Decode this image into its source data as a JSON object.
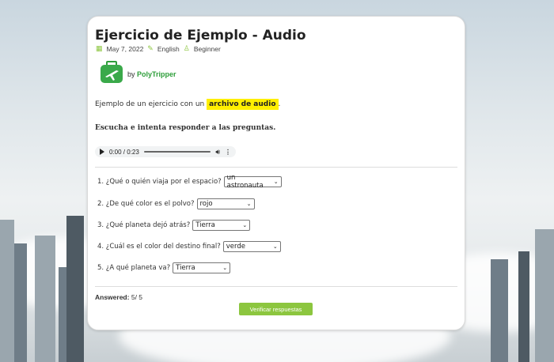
{
  "exercise": {
    "title": "Ejercicio de Ejemplo - Audio",
    "date": "May 7, 2022",
    "language": "English",
    "level": "Beginner",
    "by_prefix": "by",
    "author": "PolyTripper",
    "intro_text": "Ejemplo de un ejercicio con un",
    "intro_highlight": "archivo de audio",
    "intro_end": ".",
    "instruction": "Escucha e intenta responder a las preguntas."
  },
  "audio": {
    "time": "0:00 / 0:23"
  },
  "questions": [
    {
      "label": "1. ¿Qué o quién viaja por el espacio?",
      "value": "un astronauta"
    },
    {
      "label": "2. ¿De qué color es el polvo?",
      "value": "rojo"
    },
    {
      "label": "3. ¿Qué planeta dejó atrás?",
      "value": "Tierra"
    },
    {
      "label": "4. ¿Cuál es el color del destino final?",
      "value": "verde"
    },
    {
      "label": "5. ¿A qué planeta va?",
      "value": "Tierra"
    }
  ],
  "status": {
    "answered_label": "Answered:",
    "answered_value": "5/ 5"
  },
  "actions": {
    "verify_label": "Verificar respuestas"
  },
  "colors": {
    "accent": "#8cc63f",
    "highlight": "#ffef00",
    "brand": "#2e9e3a"
  }
}
